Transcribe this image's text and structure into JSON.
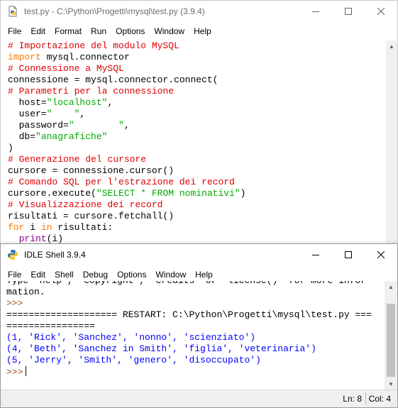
{
  "editor": {
    "title": "test.py - C:\\Python\\Progetti\\mysql\\test.py (3.9.4)",
    "menu": [
      "File",
      "Edit",
      "Format",
      "Run",
      "Options",
      "Window",
      "Help"
    ],
    "code_lines": [
      [
        {
          "t": "# Importazione del modulo MySQL",
          "c": "comment"
        }
      ],
      [
        {
          "t": "import",
          "c": "keyword"
        },
        {
          "t": " mysql.connector",
          "c": "plain"
        }
      ],
      [
        {
          "t": "# Connessione a MySQL",
          "c": "comment"
        }
      ],
      [
        {
          "t": "connessione = mysql.connector.connect(",
          "c": "plain"
        }
      ],
      [
        {
          "t": "# Parametri per la connessione",
          "c": "comment"
        }
      ],
      [
        {
          "t": "  host=",
          "c": "plain"
        },
        {
          "t": "\"localhost\"",
          "c": "string"
        },
        {
          "t": ",",
          "c": "plain"
        }
      ],
      [
        {
          "t": "  user=",
          "c": "plain"
        },
        {
          "t": "\"    \"",
          "c": "string"
        },
        {
          "t": ",",
          "c": "plain"
        }
      ],
      [
        {
          "t": "  password=",
          "c": "plain"
        },
        {
          "t": "\"        \"",
          "c": "string"
        },
        {
          "t": ",",
          "c": "plain"
        }
      ],
      [
        {
          "t": "  db=",
          "c": "plain"
        },
        {
          "t": "\"anagrafiche\"",
          "c": "string"
        }
      ],
      [
        {
          "t": ")",
          "c": "plain"
        }
      ],
      [
        {
          "t": "# Generazione del cursore",
          "c": "comment"
        }
      ],
      [
        {
          "t": "cursore = connessione.cursor()",
          "c": "plain"
        }
      ],
      [
        {
          "t": "# Comando SQL per l'estrazione dei record",
          "c": "comment"
        }
      ],
      [
        {
          "t": "cursore.execute(",
          "c": "plain"
        },
        {
          "t": "\"SELECT * FROM nominativi\"",
          "c": "string"
        },
        {
          "t": ")",
          "c": "plain"
        }
      ],
      [
        {
          "t": "# Visualizzazione dei record",
          "c": "comment"
        }
      ],
      [
        {
          "t": "risultati = cursore.fetchall()",
          "c": "plain"
        }
      ],
      [
        {
          "t": "for",
          "c": "keyword"
        },
        {
          "t": " i ",
          "c": "plain"
        },
        {
          "t": "in",
          "c": "keyword"
        },
        {
          "t": " risultati:",
          "c": "plain"
        }
      ],
      [
        {
          "t": "  ",
          "c": "plain"
        },
        {
          "t": "print",
          "c": "builtin"
        },
        {
          "t": "(i)",
          "c": "plain"
        }
      ]
    ]
  },
  "shell": {
    "title": "IDLE Shell 3.9.4",
    "menu": [
      "File",
      "Edit",
      "Shell",
      "Debug",
      "Options",
      "Window",
      "Help"
    ],
    "lines": [
      [
        {
          "t": "Type \"help\", \"copyright\", \"credits\" or \"license()\" for more infor",
          "c": "plain"
        }
      ],
      [
        {
          "t": "mation.",
          "c": "plain"
        }
      ],
      [
        {
          "t": ">>> ",
          "c": "prompt"
        }
      ],
      [
        {
          "t": "==================== RESTART: C:\\Python\\Progetti\\mysql\\test.py ===",
          "c": "plain"
        }
      ],
      [
        {
          "t": "================",
          "c": "plain"
        }
      ],
      [
        {
          "t": "(1, 'Rick', 'Sanchez', 'nonno', 'scienziato')",
          "c": "output"
        }
      ],
      [
        {
          "t": "(4, 'Beth', 'Sanchez in Smith', 'figlia', 'veterinaria')",
          "c": "output"
        }
      ],
      [
        {
          "t": "(5, 'Jerry', 'Smith', 'genero', 'disoccupato')",
          "c": "output"
        }
      ]
    ],
    "prompt": ">>>",
    "status": {
      "ln": "Ln: 8",
      "col": "Col: 4"
    }
  },
  "icons": {
    "editor_icon": "python-file-icon",
    "shell_icon": "python-shell-icon",
    "minimize": "minimize-icon",
    "maximize": "maximize-icon",
    "close": "close-icon"
  },
  "colors": {
    "comment": "#dd0000",
    "keyword": "#ff7700",
    "string": "#00aa00",
    "builtin": "#900090",
    "output": "#0000ff",
    "prompt": "#a0522d"
  }
}
